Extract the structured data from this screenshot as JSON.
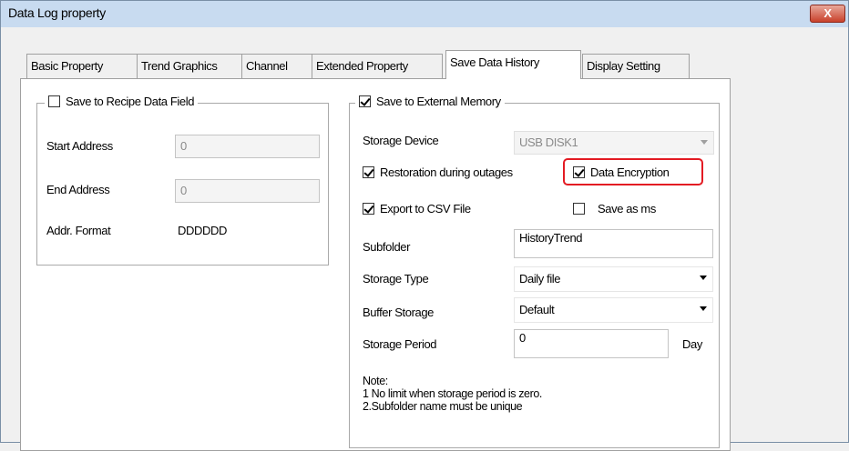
{
  "window": {
    "title": "Data Log property",
    "close_label": "X"
  },
  "tabs": [
    {
      "label": "Basic Property"
    },
    {
      "label": "Trend Graphics"
    },
    {
      "label": "Channel"
    },
    {
      "label": "Extended Property"
    },
    {
      "label": "Save Data History"
    },
    {
      "label": "Display Setting"
    }
  ],
  "recipe": {
    "title": "Save to Recipe Data Field",
    "start_label": "Start Address",
    "start_value": "0",
    "end_label": "End Address",
    "end_value": "0",
    "format_label": "Addr. Format",
    "format_value": "DDDDDD"
  },
  "external": {
    "title": "Save to External Memory",
    "storage_device_label": "Storage Device",
    "storage_device_value": "USB DISK1",
    "restoration_label": "Restoration during outages",
    "encryption_label": "Data Encryption",
    "csv_label": "Export to CSV File",
    "save_ms_label": "Save as ms",
    "subfolder_label": "Subfolder",
    "subfolder_value": "HistoryTrend",
    "storage_type_label": "Storage Type",
    "storage_type_value": "Daily file",
    "buffer_label": "Buffer Storage",
    "buffer_value": "Default",
    "period_label": "Storage Period",
    "period_value": "0",
    "period_unit": "Day",
    "note_title": "Note:",
    "note_line1": "1 No limit when storage period is zero.",
    "note_line2": "2.Subfolder name must be unique"
  },
  "colors": {
    "highlight": "#e31b23",
    "titlebar": "#c8dbf0"
  }
}
